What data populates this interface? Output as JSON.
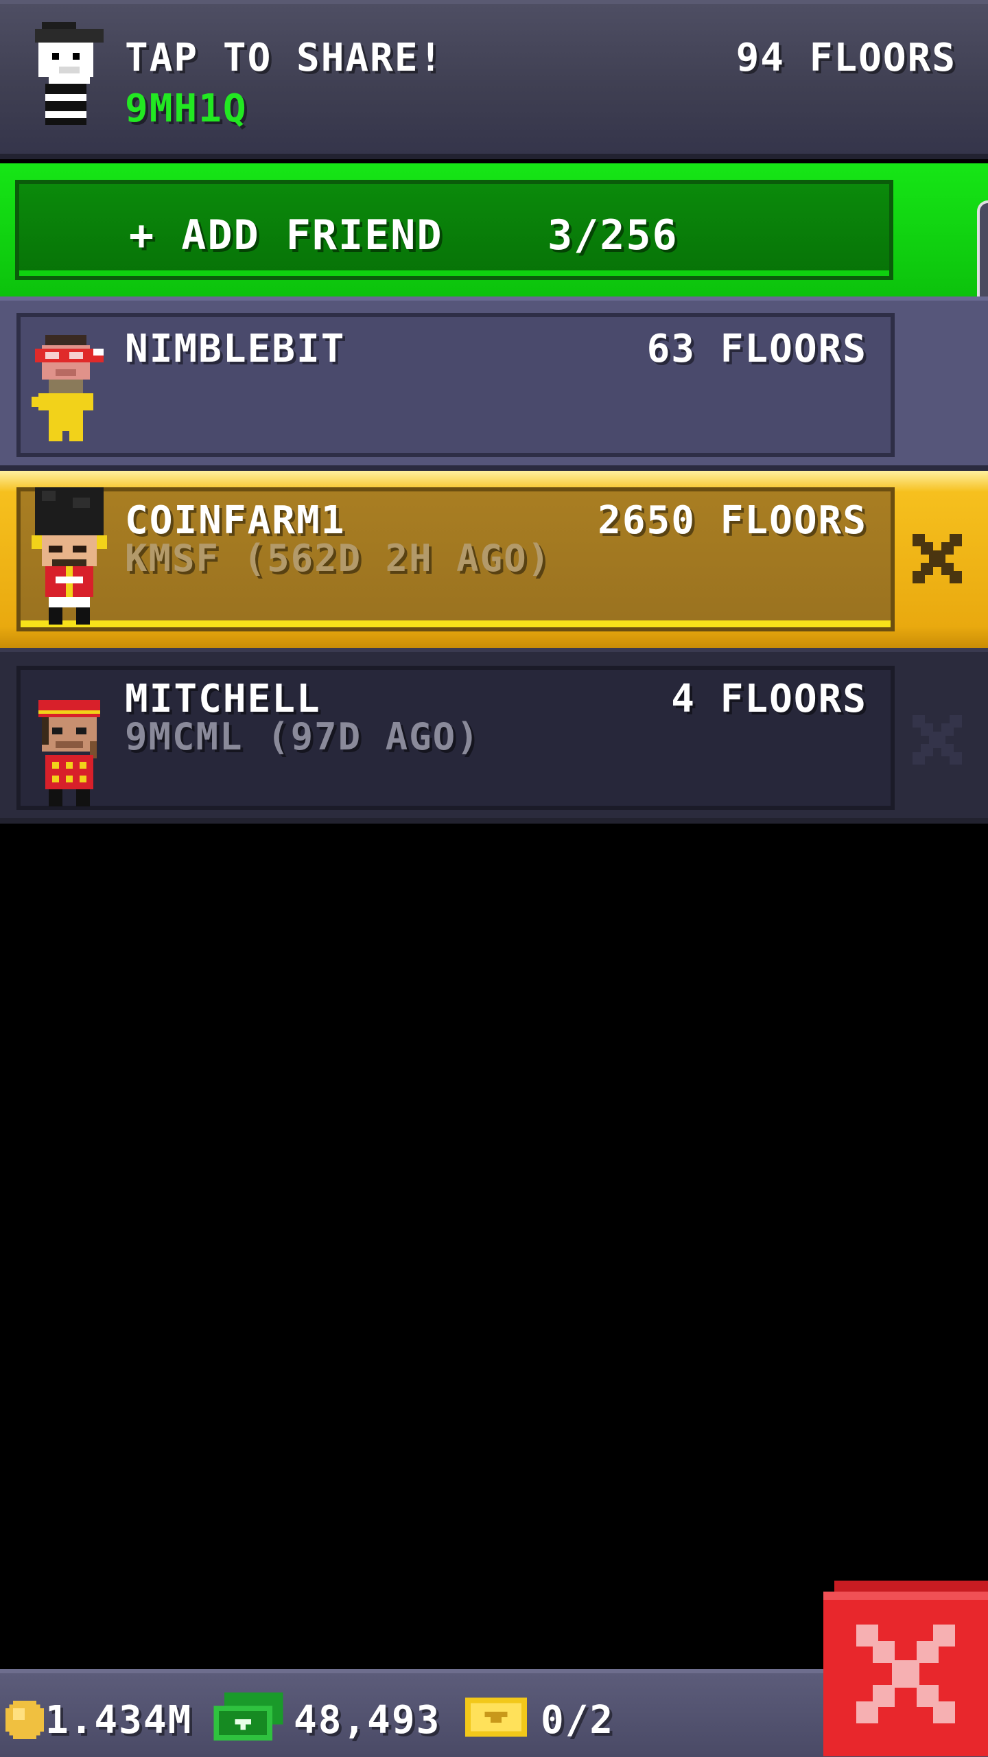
{
  "header": {
    "share_label": "TAP TO SHARE!",
    "my_code": "9MH1Q",
    "my_floors": "94 FLOORS"
  },
  "add_friend": {
    "label": "+ ADD FRIEND",
    "count": "3/256"
  },
  "friends": [
    {
      "name": "NIMBLEBIT",
      "floors": "63 FLOORS",
      "subtitle": "",
      "avatar": "red-glasses-avatar-icon"
    },
    {
      "name": "COINFARM1",
      "floors": "2650 FLOORS",
      "subtitle": "KMSF (562D 2H AGO)",
      "avatar": "royal-guard-avatar-icon"
    },
    {
      "name": "MITCHELL",
      "floors": "4 FLOORS",
      "subtitle": "9MCML (97D AGO)",
      "avatar": "bellhop-avatar-icon"
    }
  ],
  "bottom_bar": {
    "coins": "1.434M",
    "bux": "48,493",
    "tickets": "0/2"
  },
  "colors": {
    "accent_green": "#0cc20c",
    "code_green": "#22e822",
    "gold": "#e9a90f",
    "close_red": "#e8272c"
  },
  "icons": {
    "coin": "coin-icon",
    "bux": "bux-icon",
    "ticket": "golden-ticket-icon",
    "close": "close-icon",
    "remove": "remove-friend-icon"
  }
}
